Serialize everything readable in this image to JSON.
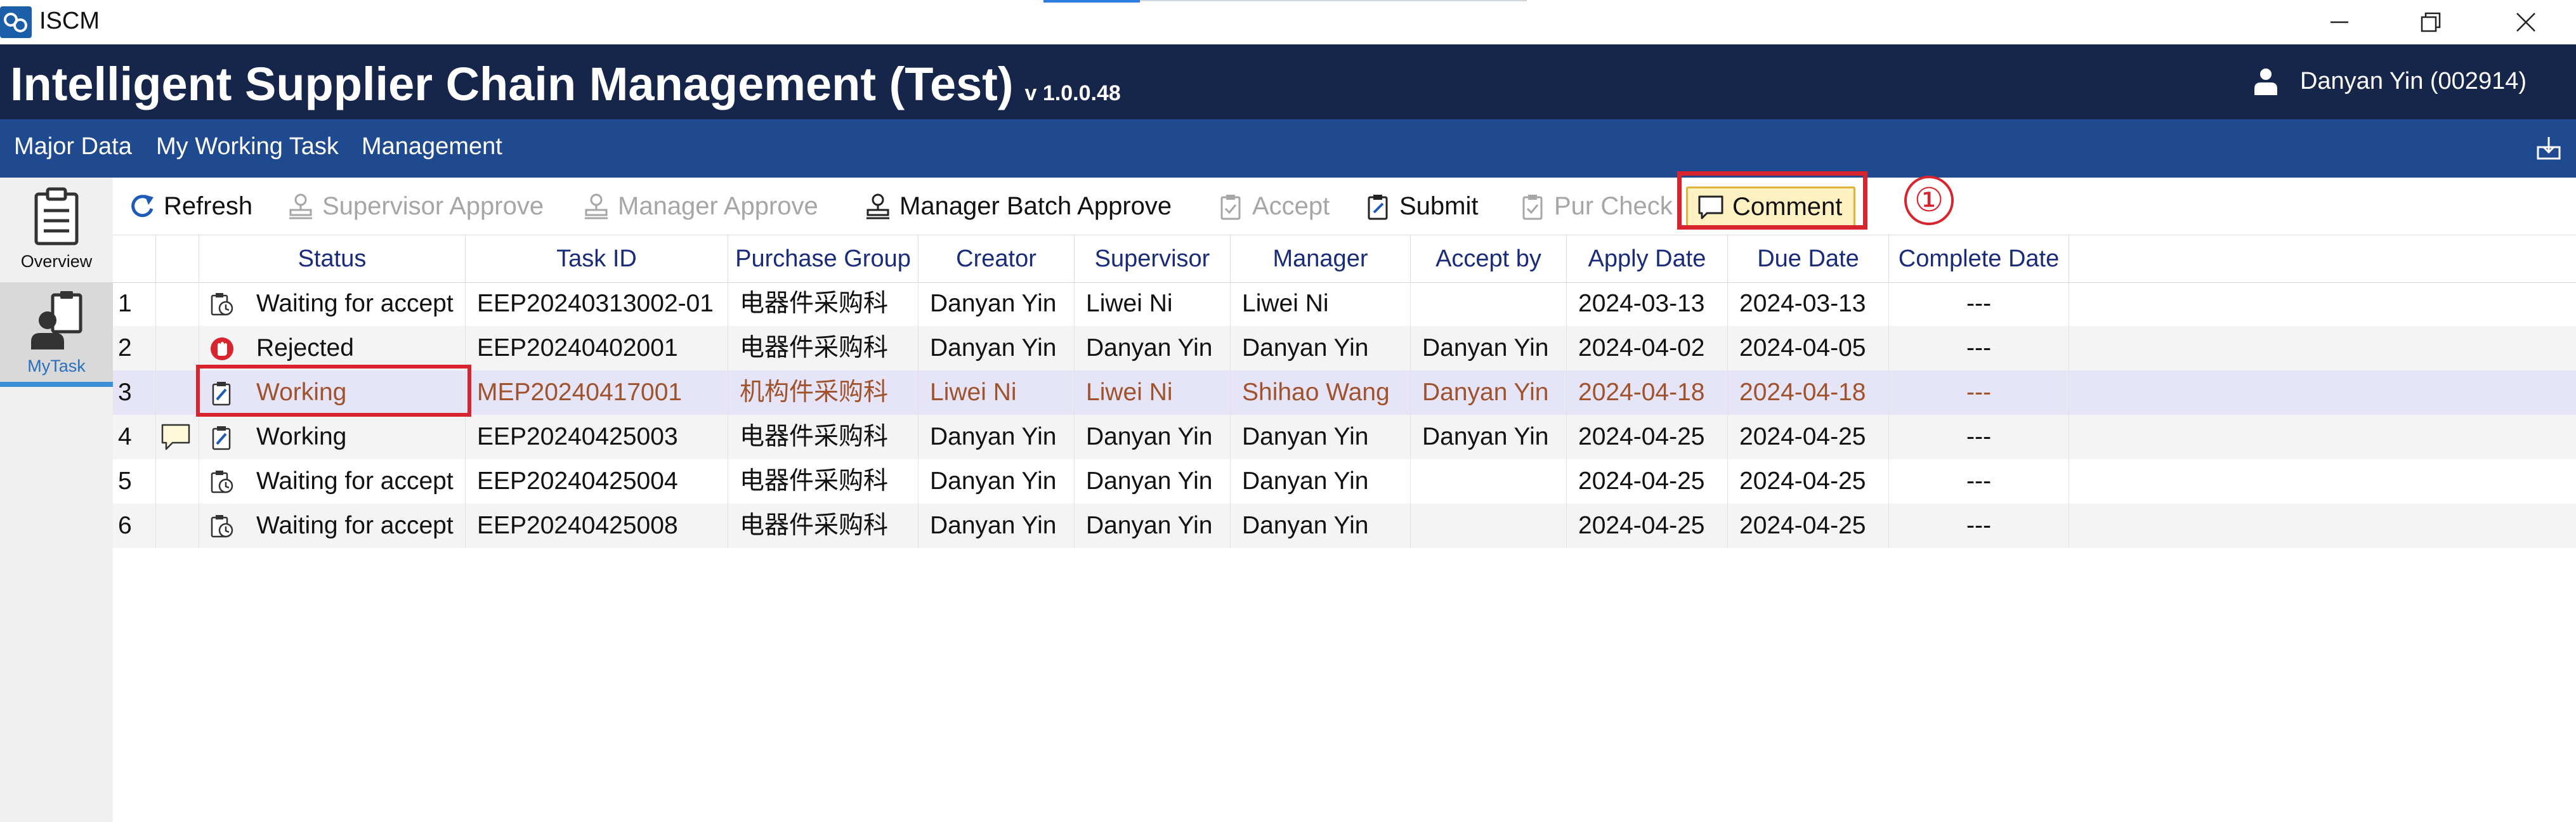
{
  "window": {
    "title": "ISCM",
    "controls": [
      "minimize-icon",
      "restore-icon",
      "close-icon"
    ]
  },
  "header": {
    "title": "Intelligent Supplier Chain Management (Test)",
    "version": "v 1.0.0.48",
    "user": "Danyan Yin (002914)"
  },
  "menu": {
    "items": [
      "Major Data",
      "My Working Task",
      "Management"
    ]
  },
  "nav": {
    "overview_label": "Overview",
    "mytask_label": "MyTask"
  },
  "toolbar": {
    "refresh": "Refresh",
    "supervisor_approve": "Supervisor Approve",
    "manager_approve": "Manager Approve",
    "manager_batch_approve": "Manager Batch Approve",
    "accept": "Accept",
    "submit": "Submit",
    "pur_check": "Pur Check",
    "comment": "Comment",
    "step_marker": "①"
  },
  "grid": {
    "columns": [
      "Status",
      "Task ID",
      "Purchase Group",
      "Creator",
      "Supervisor",
      "Manager",
      "Accept by",
      "Apply Date",
      "Due Date",
      "Complete Date"
    ],
    "rows": [
      {
        "no": "1",
        "comment": false,
        "status_icon": "clock-clipboard-icon",
        "status": "Waiting for accept",
        "task_id": "EEP20240313002-01",
        "purchase_group": "电器件采购科",
        "creator": "Danyan Yin",
        "supervisor": "Liwei Ni",
        "manager": "Liwei Ni",
        "accept_by": "",
        "apply_date": "2024-03-13",
        "due_date": "2024-03-13",
        "complete_date": "---"
      },
      {
        "no": "2",
        "comment": false,
        "status_icon": "stop-hand-icon",
        "status": "Rejected",
        "task_id": "EEP20240402001",
        "purchase_group": "电器件采购科",
        "creator": "Danyan Yin",
        "supervisor": "Danyan Yin",
        "manager": "Danyan Yin",
        "accept_by": "Danyan Yin",
        "apply_date": "2024-04-02",
        "due_date": "2024-04-05",
        "complete_date": "---"
      },
      {
        "no": "3",
        "comment": false,
        "status_icon": "edit-clipboard-icon",
        "status": "Working",
        "task_id": "MEP20240417001",
        "purchase_group": "机构件采购科",
        "creator": "Liwei Ni",
        "supervisor": "Liwei Ni",
        "manager": "Shihao Wang",
        "accept_by": "Danyan Yin",
        "apply_date": "2024-04-18",
        "due_date": "2024-04-18",
        "complete_date": "---"
      },
      {
        "no": "4",
        "comment": true,
        "status_icon": "edit-clipboard-icon",
        "status": "Working",
        "task_id": "EEP20240425003",
        "purchase_group": "电器件采购科",
        "creator": "Danyan Yin",
        "supervisor": "Danyan Yin",
        "manager": "Danyan Yin",
        "accept_by": "Danyan Yin",
        "apply_date": "2024-04-25",
        "due_date": "2024-04-25",
        "complete_date": "---"
      },
      {
        "no": "5",
        "comment": false,
        "status_icon": "clock-clipboard-icon",
        "status": "Waiting for accept",
        "task_id": "EEP20240425004",
        "purchase_group": "电器件采购科",
        "creator": "Danyan Yin",
        "supervisor": "Danyan Yin",
        "manager": "Danyan Yin",
        "accept_by": "",
        "apply_date": "2024-04-25",
        "due_date": "2024-04-25",
        "complete_date": "---"
      },
      {
        "no": "6",
        "comment": false,
        "status_icon": "clock-clipboard-icon",
        "status": "Waiting for accept",
        "task_id": "EEP20240425008",
        "purchase_group": "电器件采购科",
        "creator": "Danyan Yin",
        "supervisor": "Danyan Yin",
        "manager": "Danyan Yin",
        "accept_by": "",
        "apply_date": "2024-04-25",
        "due_date": "2024-04-25",
        "complete_date": "---"
      }
    ]
  },
  "colors": {
    "header_bg": "#16264a",
    "menu_bg": "#1f4a8f",
    "highlight_red": "#d8242f",
    "selected_row_bg": "#e5e5f7",
    "selected_row_text": "#a0522d",
    "column_header_text": "#1a2b7a",
    "comment_button_bg": "#fff1c2"
  }
}
